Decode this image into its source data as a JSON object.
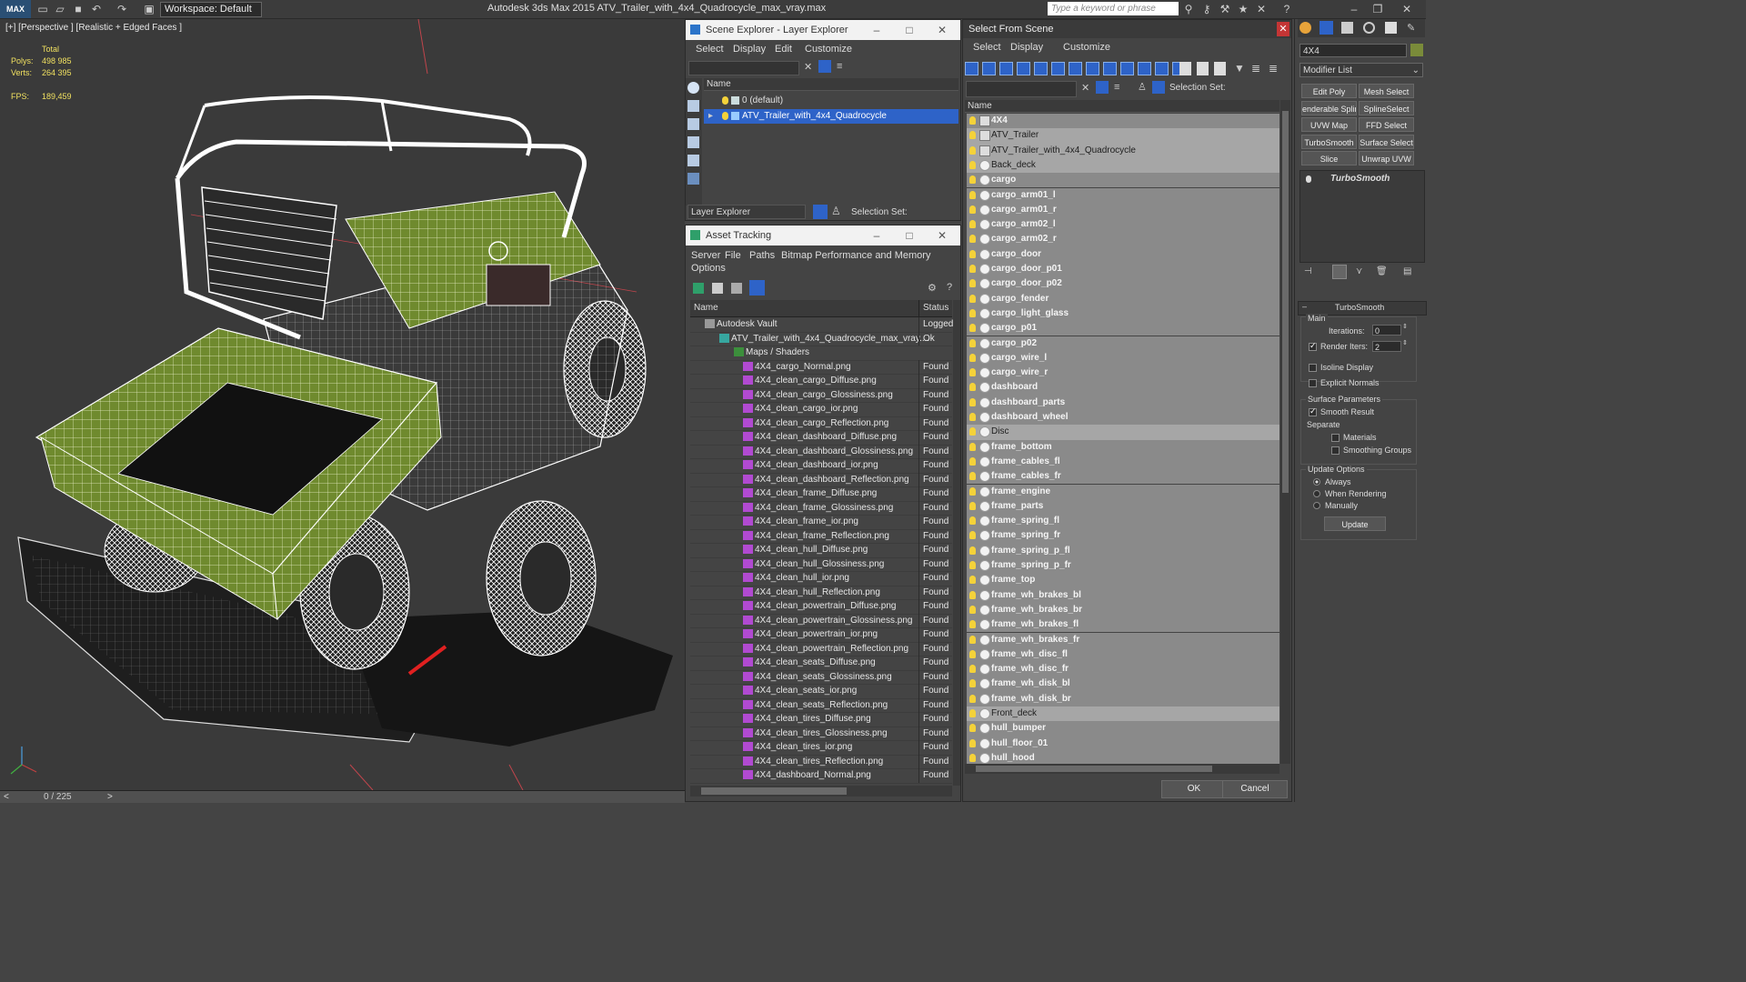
{
  "app": {
    "logo": "MAX",
    "title": "Autodesk 3ds Max  2015     ATV_Trailer_with_4x4_Quadrocycle_max_vray.max",
    "workspace": "Workspace: Default",
    "search_placeholder": "Type a keyword or phrase"
  },
  "viewport": {
    "label": "[+] [Perspective ] [Realistic + Edged Faces ]",
    "stats_header": "Total",
    "polys_label": "Polys:",
    "polys_value": "498 985",
    "verts_label": "Verts:",
    "verts_value": "264 395",
    "fps_label": "FPS:",
    "fps_value": "189,459"
  },
  "timeline": {
    "frame": "0 / 225",
    "prev": "<",
    "next": ">"
  },
  "scene_explorer": {
    "title": "Scene Explorer - Layer Explorer",
    "menu": [
      "Select",
      "Display",
      "Edit",
      "Customize"
    ],
    "column": "Name",
    "layers": [
      "0 (default)",
      "ATV_Trailer_with_4x4_Quadrocycle"
    ],
    "bottom_label": "Layer Explorer",
    "selection_set": "Selection Set:"
  },
  "asset_tracking": {
    "title": "Asset Tracking",
    "menu": [
      "Server",
      "File",
      "Paths",
      "Bitmap Performance and Memory",
      "Options"
    ],
    "col_name": "Name",
    "col_status": "Status",
    "rows": [
      {
        "name": "Autodesk Vault",
        "status": "Logged",
        "level": 1,
        "type": "vault"
      },
      {
        "name": "ATV_Trailer_with_4x4_Quadrocycle_max_vray....",
        "status": "Ok",
        "level": 2,
        "type": "max"
      },
      {
        "name": "Maps / Shaders",
        "status": "",
        "level": 3,
        "type": "folder"
      },
      {
        "name": "4X4_cargo_Normal.png",
        "status": "Found",
        "level": 4,
        "type": "png"
      },
      {
        "name": "4X4_clean_cargo_Diffuse.png",
        "status": "Found",
        "level": 4,
        "type": "png"
      },
      {
        "name": "4X4_clean_cargo_Glossiness.png",
        "status": "Found",
        "level": 4,
        "type": "png"
      },
      {
        "name": "4X4_clean_cargo_ior.png",
        "status": "Found",
        "level": 4,
        "type": "png"
      },
      {
        "name": "4X4_clean_cargo_Reflection.png",
        "status": "Found",
        "level": 4,
        "type": "png"
      },
      {
        "name": "4X4_clean_dashboard_Diffuse.png",
        "status": "Found",
        "level": 4,
        "type": "png"
      },
      {
        "name": "4X4_clean_dashboard_Glossiness.png",
        "status": "Found",
        "level": 4,
        "type": "png"
      },
      {
        "name": "4X4_clean_dashboard_ior.png",
        "status": "Found",
        "level": 4,
        "type": "png"
      },
      {
        "name": "4X4_clean_dashboard_Reflection.png",
        "status": "Found",
        "level": 4,
        "type": "png"
      },
      {
        "name": "4X4_clean_frame_Diffuse.png",
        "status": "Found",
        "level": 4,
        "type": "png"
      },
      {
        "name": "4X4_clean_frame_Glossiness.png",
        "status": "Found",
        "level": 4,
        "type": "png"
      },
      {
        "name": "4X4_clean_frame_ior.png",
        "status": "Found",
        "level": 4,
        "type": "png"
      },
      {
        "name": "4X4_clean_frame_Reflection.png",
        "status": "Found",
        "level": 4,
        "type": "png"
      },
      {
        "name": "4X4_clean_hull_Diffuse.png",
        "status": "Found",
        "level": 4,
        "type": "png"
      },
      {
        "name": "4X4_clean_hull_Glossiness.png",
        "status": "Found",
        "level": 4,
        "type": "png"
      },
      {
        "name": "4X4_clean_hull_ior.png",
        "status": "Found",
        "level": 4,
        "type": "png"
      },
      {
        "name": "4X4_clean_hull_Reflection.png",
        "status": "Found",
        "level": 4,
        "type": "png"
      },
      {
        "name": "4X4_clean_powertrain_Diffuse.png",
        "status": "Found",
        "level": 4,
        "type": "png"
      },
      {
        "name": "4X4_clean_powertrain_Glossiness.png",
        "status": "Found",
        "level": 4,
        "type": "png"
      },
      {
        "name": "4X4_clean_powertrain_ior.png",
        "status": "Found",
        "level": 4,
        "type": "png"
      },
      {
        "name": "4X4_clean_powertrain_Reflection.png",
        "status": "Found",
        "level": 4,
        "type": "png"
      },
      {
        "name": "4X4_clean_seats_Diffuse.png",
        "status": "Found",
        "level": 4,
        "type": "png"
      },
      {
        "name": "4X4_clean_seats_Glossiness.png",
        "status": "Found",
        "level": 4,
        "type": "png"
      },
      {
        "name": "4X4_clean_seats_ior.png",
        "status": "Found",
        "level": 4,
        "type": "png"
      },
      {
        "name": "4X4_clean_seats_Reflection.png",
        "status": "Found",
        "level": 4,
        "type": "png"
      },
      {
        "name": "4X4_clean_tires_Diffuse.png",
        "status": "Found",
        "level": 4,
        "type": "png"
      },
      {
        "name": "4X4_clean_tires_Glossiness.png",
        "status": "Found",
        "level": 4,
        "type": "png"
      },
      {
        "name": "4X4_clean_tires_ior.png",
        "status": "Found",
        "level": 4,
        "type": "png"
      },
      {
        "name": "4X4_clean_tires_Reflection.png",
        "status": "Found",
        "level": 4,
        "type": "png"
      },
      {
        "name": "4X4_dashboard_Normal.png",
        "status": "Found",
        "level": 4,
        "type": "png"
      }
    ]
  },
  "select_from_scene": {
    "title": "Select From Scene",
    "menu": [
      "Select",
      "Display",
      "Customize"
    ],
    "selection_set": "Selection Set:",
    "column": "Name",
    "items": [
      {
        "name": "4X4",
        "kind": "group",
        "bold": true
      },
      {
        "name": "ATV_Trailer",
        "kind": "group",
        "bold": false
      },
      {
        "name": "ATV_Trailer_with_4x4_Quadrocycle",
        "kind": "group",
        "bold": false
      },
      {
        "name": "Back_deck",
        "kind": "object",
        "bold": false
      },
      {
        "name": "cargo",
        "kind": "object",
        "bold": true
      },
      {
        "name": "cargo_arm01_l",
        "kind": "object",
        "bold": true
      },
      {
        "name": "cargo_arm01_r",
        "kind": "object",
        "bold": true
      },
      {
        "name": "cargo_arm02_l",
        "kind": "object",
        "bold": true
      },
      {
        "name": "cargo_arm02_r",
        "kind": "object",
        "bold": true
      },
      {
        "name": "cargo_door",
        "kind": "object",
        "bold": true
      },
      {
        "name": "cargo_door_p01",
        "kind": "object",
        "bold": true
      },
      {
        "name": "cargo_door_p02",
        "kind": "object",
        "bold": true
      },
      {
        "name": "cargo_fender",
        "kind": "object",
        "bold": true
      },
      {
        "name": "cargo_light_glass",
        "kind": "object",
        "bold": true
      },
      {
        "name": "cargo_p01",
        "kind": "object",
        "bold": true
      },
      {
        "name": "cargo_p02",
        "kind": "object",
        "bold": true
      },
      {
        "name": "cargo_wire_l",
        "kind": "object",
        "bold": true
      },
      {
        "name": "cargo_wire_r",
        "kind": "object",
        "bold": true
      },
      {
        "name": "dashboard",
        "kind": "object",
        "bold": true
      },
      {
        "name": "dashboard_parts",
        "kind": "object",
        "bold": true
      },
      {
        "name": "dashboard_wheel",
        "kind": "object",
        "bold": true
      },
      {
        "name": "Disc",
        "kind": "object",
        "bold": false
      },
      {
        "name": "frame_bottom",
        "kind": "object",
        "bold": true
      },
      {
        "name": "frame_cables_fl",
        "kind": "object",
        "bold": true
      },
      {
        "name": "frame_cables_fr",
        "kind": "object",
        "bold": true
      },
      {
        "name": "frame_engine",
        "kind": "object",
        "bold": true
      },
      {
        "name": "frame_parts",
        "kind": "object",
        "bold": true
      },
      {
        "name": "frame_spring_fl",
        "kind": "object",
        "bold": true
      },
      {
        "name": "frame_spring_fr",
        "kind": "object",
        "bold": true
      },
      {
        "name": "frame_spring_p_fl",
        "kind": "object",
        "bold": true
      },
      {
        "name": "frame_spring_p_fr",
        "kind": "object",
        "bold": true
      },
      {
        "name": "frame_top",
        "kind": "object",
        "bold": true
      },
      {
        "name": "frame_wh_brakes_bl",
        "kind": "object",
        "bold": true
      },
      {
        "name": "frame_wh_brakes_br",
        "kind": "object",
        "bold": true
      },
      {
        "name": "frame_wh_brakes_fl",
        "kind": "object",
        "bold": true
      },
      {
        "name": "frame_wh_brakes_fr",
        "kind": "object",
        "bold": true
      },
      {
        "name": "frame_wh_disc_fl",
        "kind": "object",
        "bold": true
      },
      {
        "name": "frame_wh_disc_fr",
        "kind": "object",
        "bold": true
      },
      {
        "name": "frame_wh_disk_bl",
        "kind": "object",
        "bold": true
      },
      {
        "name": "frame_wh_disk_br",
        "kind": "object",
        "bold": true
      },
      {
        "name": "Front_deck",
        "kind": "object",
        "bold": false
      },
      {
        "name": "hull_bumper",
        "kind": "object",
        "bold": true
      },
      {
        "name": "hull_floor_01",
        "kind": "object",
        "bold": true
      },
      {
        "name": "hull_hood",
        "kind": "object",
        "bold": true
      }
    ],
    "ok": "OK",
    "cancel": "Cancel"
  },
  "command_panel": {
    "object_name": "4X4",
    "modifier_list": "Modifier List",
    "buttons": [
      "Edit Poly",
      "Mesh Select",
      "enderable Splir",
      "SplineSelect",
      "UVW Map",
      "FFD Select",
      "TurboSmooth",
      "Surface Select",
      "Slice",
      "Unwrap UVW"
    ],
    "stack_item": "TurboSmooth",
    "rollout_title": "TurboSmooth",
    "main_label": "Main",
    "iterations_label": "Iterations:",
    "iterations_value": "0",
    "render_iters_label": "Render Iters:",
    "render_iters_value": "2",
    "isoline": "Isoline Display",
    "explicit_normals": "Explicit Normals",
    "surface_params": "Surface Parameters",
    "smooth_result": "Smooth Result",
    "separate": "Separate",
    "materials": "Materials",
    "smoothing_groups": "Smoothing Groups",
    "update_options": "Update Options",
    "always": "Always",
    "when_rendering": "When Rendering",
    "manually": "Manually",
    "update_button": "Update"
  },
  "colors": {
    "cargo_green": "#6f8a2e",
    "wire": "#ffffff",
    "selection_blue": "#2e63c8",
    "bulb": "#f4d23a"
  }
}
